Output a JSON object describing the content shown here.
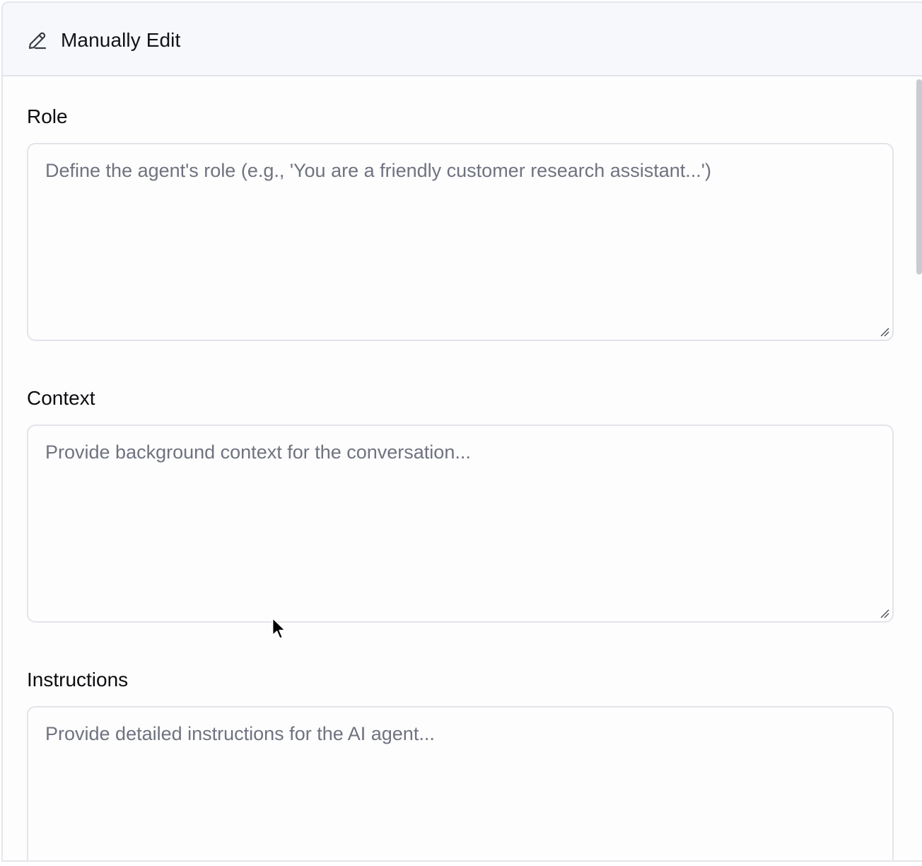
{
  "header": {
    "icon": "pencil-icon",
    "title": "Manually Edit"
  },
  "fields": [
    {
      "label": "Role",
      "placeholder": "Define the agent's role (e.g., 'You are a friendly customer research assistant...')",
      "value": ""
    },
    {
      "label": "Context",
      "placeholder": "Provide background context for the conversation...",
      "value": ""
    },
    {
      "label": "Instructions",
      "placeholder": "Provide detailed instructions for the AI agent...",
      "value": ""
    }
  ],
  "colors": {
    "header_bg": "#f7f8fc",
    "border": "#e2e4ea",
    "placeholder": "#6f7380",
    "text": "#0c0d10"
  }
}
